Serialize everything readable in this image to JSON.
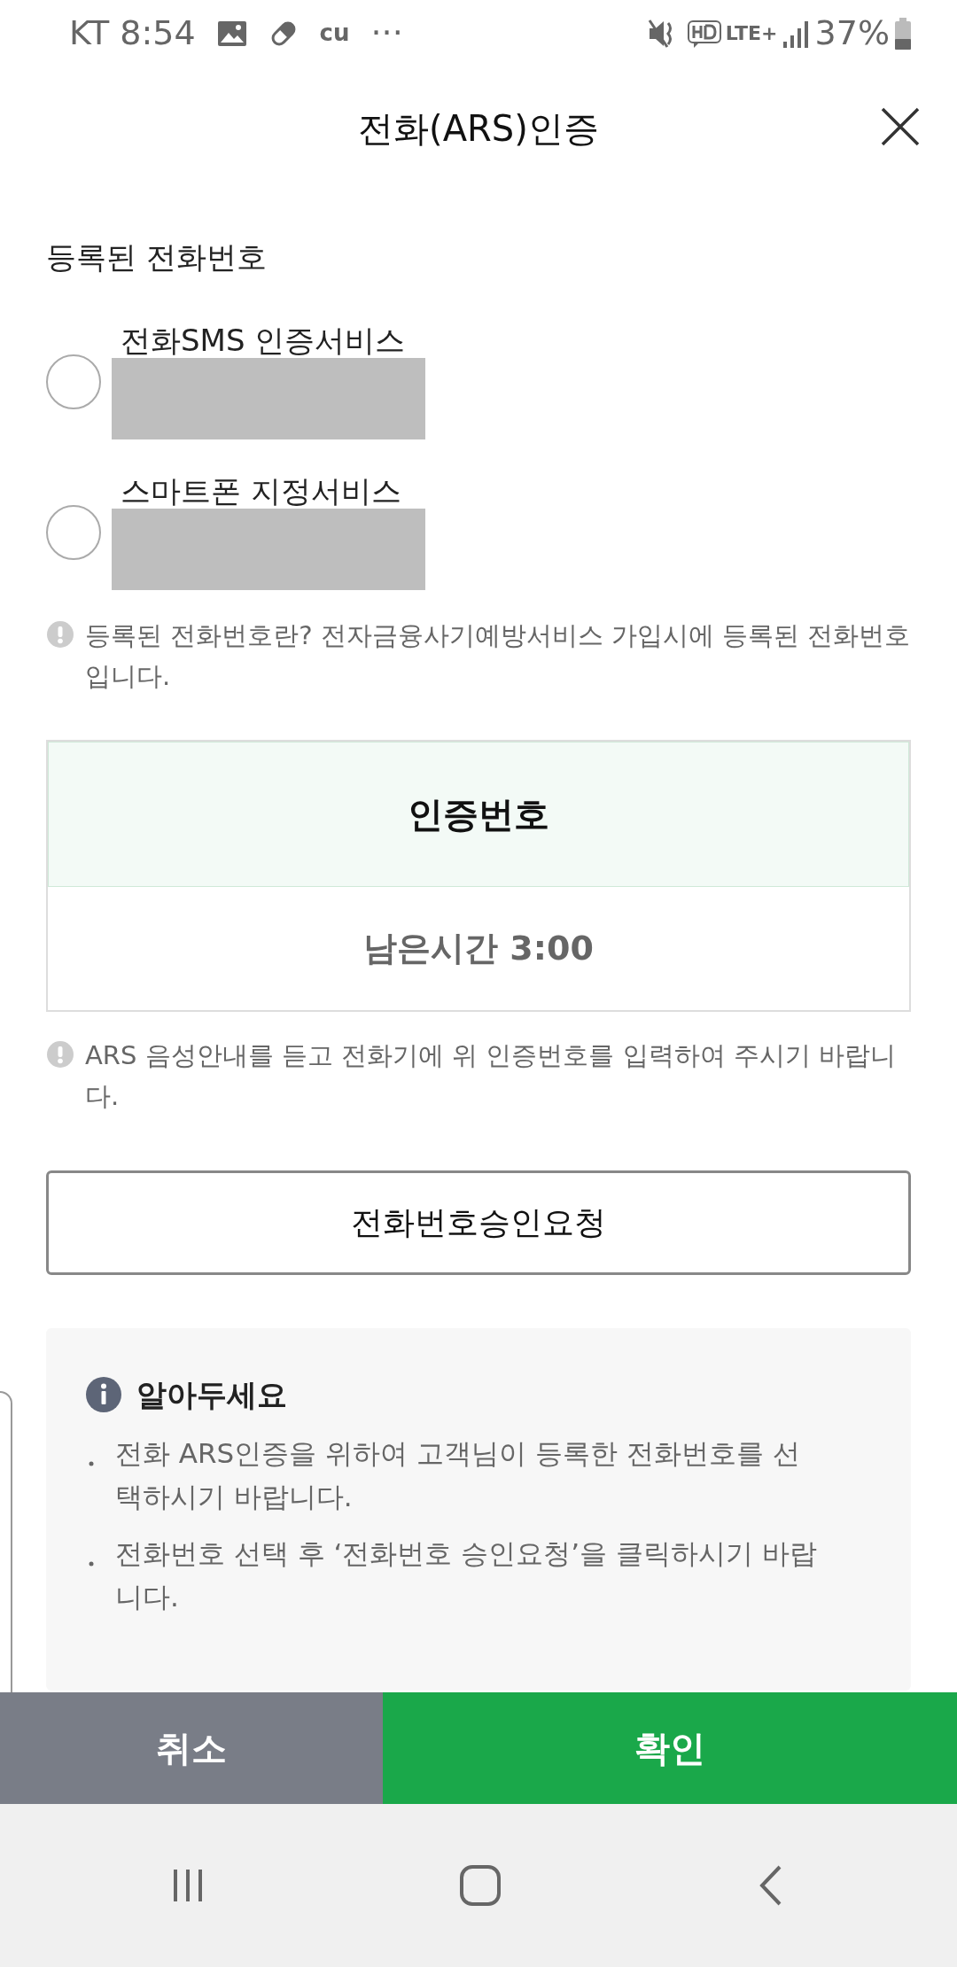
{
  "status_bar": {
    "carrier_time": "KT 8:54",
    "more": "···",
    "cu": "cu",
    "network": "LTE+",
    "battery": "37%"
  },
  "header": {
    "title": "전화(ARS)인증"
  },
  "phones": {
    "heading": "등록된 전화번호",
    "options": [
      {
        "label": "전화SMS 인증서비스",
        "selected": false
      },
      {
        "label": "스마트폰 지정서비스",
        "selected": false
      }
    ],
    "notice": "등록된 전화번호란? 전자금융사기예방서비스 가입시에 등록된 전화번호입니다."
  },
  "code_box": {
    "heading": "인증번호",
    "timer": "남은시간 3:00"
  },
  "ars_notice": "ARS 음성안내를 듣고 전화기에 위 인증번호를 입력하여 주시기 바랍니다.",
  "request_button": "전화번호승인요청",
  "info": {
    "title": "알아두세요",
    "items": [
      "전화 ARS인증을 위하여 고객님이 등록한 전화번호를 선택하시기 바랍니다.",
      "전화번호 선택 후 ‘전화번호 승인요청’을 클릭하시기 바랍니다."
    ]
  },
  "actions": [
    {
      "label": "취소",
      "kind": "secondary"
    },
    {
      "label": "확인",
      "kind": "primary"
    }
  ]
}
